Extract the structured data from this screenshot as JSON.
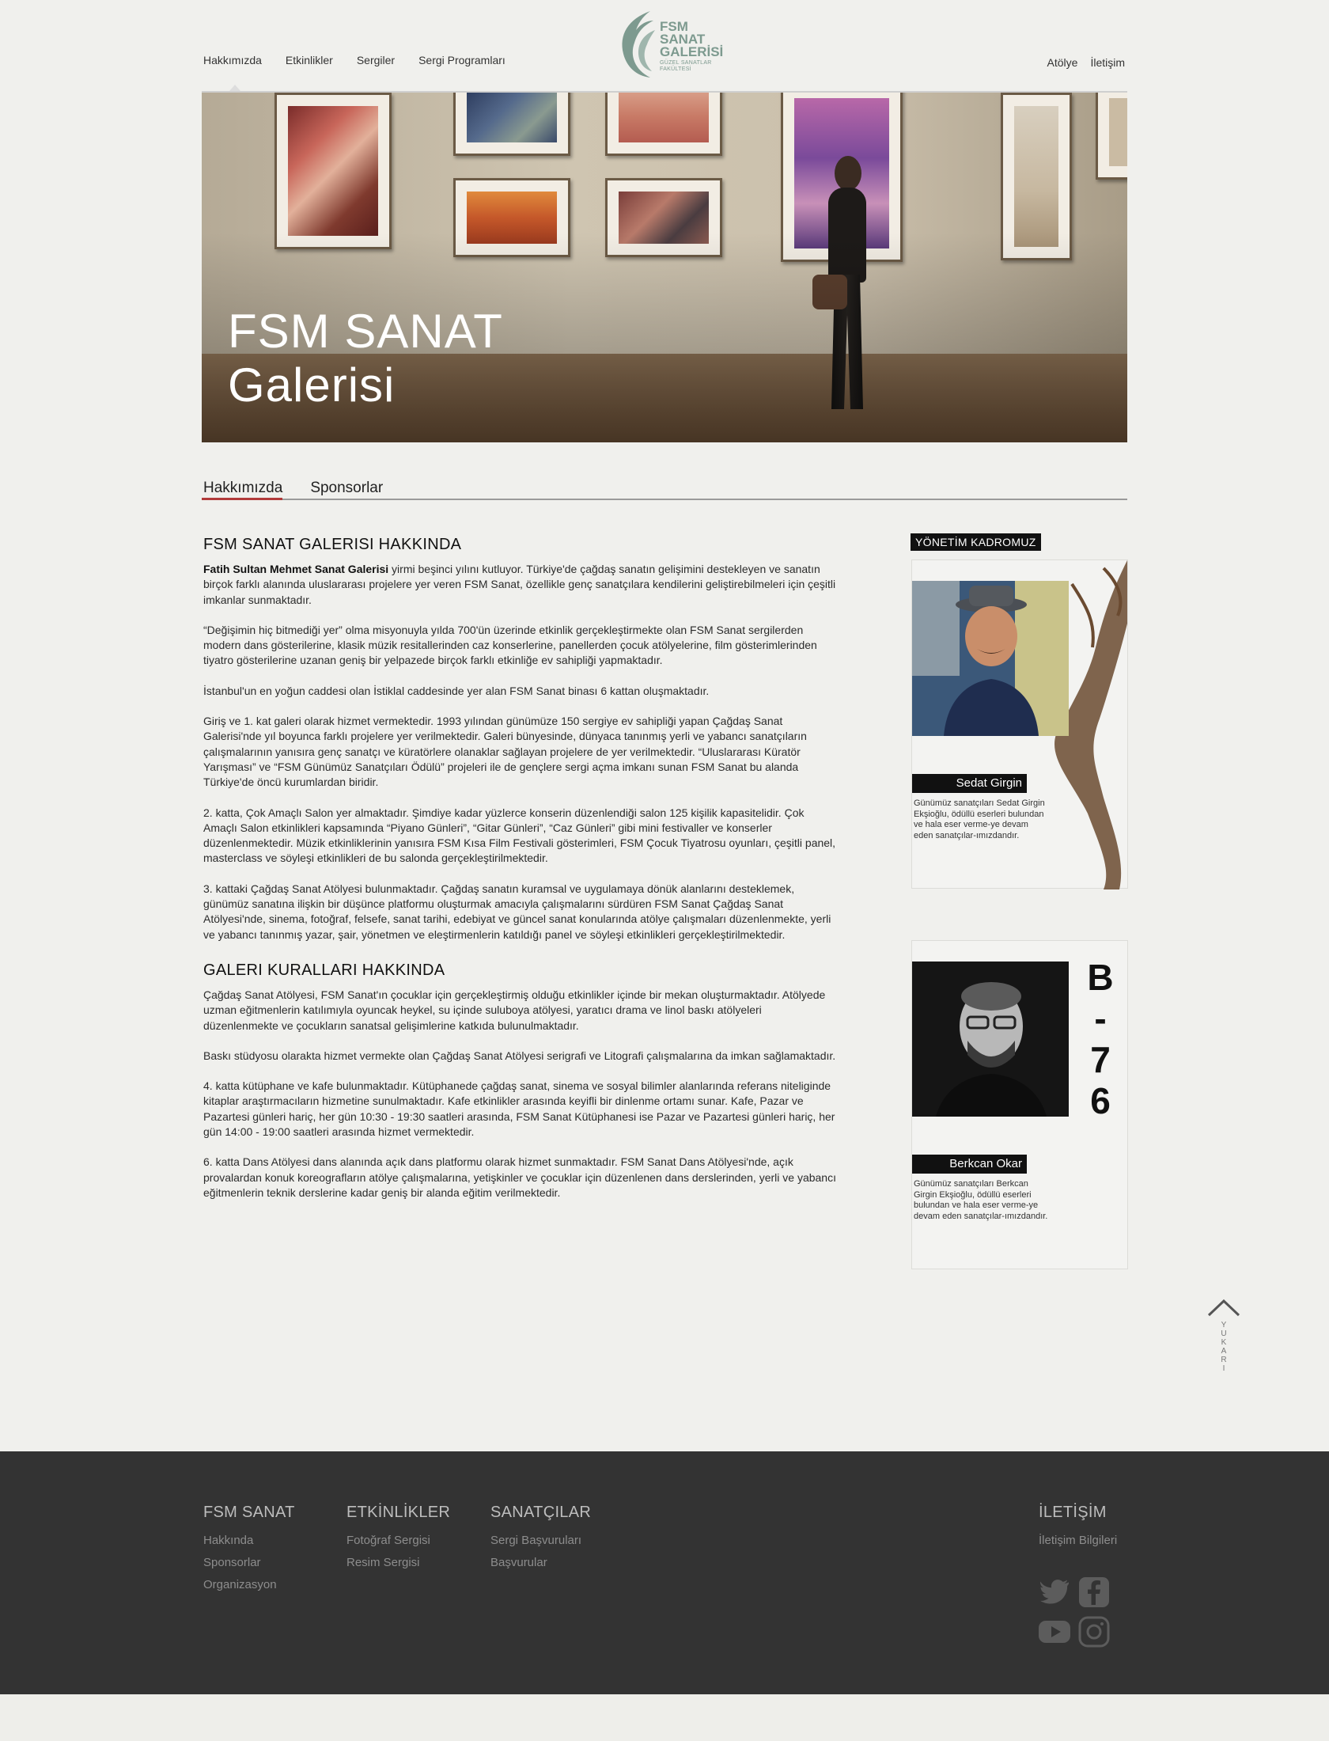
{
  "header": {
    "nav_left": [
      "Hakkımızda",
      "Etkinlikler",
      "Sergiler",
      "Sergi Programları"
    ],
    "nav_right": [
      "Atölye",
      "İletişim"
    ],
    "logo": {
      "line1": "FSM",
      "line2": "SANAT",
      "line3": "GALERİSİ",
      "sub1": "GÜZEL SANATLAR",
      "sub2": "FAKÜLTESİ"
    }
  },
  "hero": {
    "title_line1": "FSM SANAT",
    "title_line2": "Galerisi"
  },
  "subtabs": [
    "Hakkımızda",
    "Sponsorlar"
  ],
  "main": {
    "heading1": "FSM SANAT GALERISI HAKKINDA",
    "intro_bold": "Fatih Sultan Mehmet Sanat Galerisi",
    "intro_rest": " yirmi beşinci yılını kutluyor. Türkiye'de çağdaş sanatın gelişimini destekleyen ve sanatın birçok farklı alanında uluslararası projelere yer veren FSM Sanat, özellikle genç sanatçılara kendilerini geliştirebilmeleri için çeşitli imkanlar sunmaktadır.",
    "paragraphs": [
      "“Değişimin hiç bitmediği yer” olma misyonuyla yılda 700'ün üzerinde etkinlik gerçekleştirmekte olan FSM Sanat sergilerden modern dans gösterilerine, klasik müzik resitallerinden caz konserlerine, panellerden çocuk atölyelerine, film gösterimlerinden tiyatro gösterilerine  uzanan geniş bir yelpazede birçok farklı etkinliğe ev sahipliği yapmaktadır.",
      "İstanbul'un en yoğun caddesi olan İstiklal caddesinde yer alan FSM Sanat binası 6 kattan oluşmaktadır.",
      "Giriş ve 1. kat galeri olarak hizmet vermektedir. 1993 yılından günümüze 150  sergiye ev sahipliği yapan Çağdaş Sanat Galerisi'nde yıl boyunca farklı projelere yer verilmektedir.  Galeri bünyesinde, dünyaca tanınmış yerli ve yabancı sanatçıların çalışmalarının yanısıra  genç sanatçı ve küratörlere olanaklar sağlayan  projelere de yer verilmektedir. “Uluslararası Küratör Yarışması” ve “FSM Günümüz Sanatçıları Ödülü” projeleri ile de gençlere sergi açma imkanı sunan FSM Sanat bu alanda Türkiye'de öncü kurumlardan biridir.",
      "2. katta, Çok Amaçlı Salon yer almaktadır.  Şimdiye kadar yüzlerce konserin  düzenlendiği salon 125 kişilik kapasitelidir.   Çok Amaçlı Salon etkinlikleri kapsamında “Piyano Günleri”, “Gitar Günleri”, “Caz Günleri” gibi mini festivaller ve konserler düzenlenmektedir.  Müzik etkinliklerinin yanısıra FSM Kısa Film Festivali gösterimleri, FSM Çocuk Tiyatrosu oyunları, çeşitli panel, masterclass ve söyleşi etkinlikleri de bu salonda gerçekleştirilmektedir.",
      "3. kattaki Çağdaş Sanat Atölyesi bulunmaktadır. Çağdaş sanatın kuramsal ve uygulamaya dönük alanlarını desteklemek, günümüz sanatına ilişkin bir düşünce platformu oluşturmak amacıyla çalışmalarını sürdüren FSM Sanat Çağdaş Sanat Atölyesi'nde, sinema, fotoğraf, felsefe, sanat tarihi, edebiyat ve güncel sanat konularında atölye çalışmaları düzenlenmekte, yerli ve yabancı tanınmış yazar, şair, yönetmen ve eleştirmenlerin katıldığı panel ve söyleşi etkinlikleri gerçekleştirilmektedir."
    ],
    "heading2": "GALERI KURALLARI HAKKINDA",
    "paragraphs2": [
      "Çağdaş Sanat Atölyesi, FSM Sanat'ın çocuklar için gerçekleştirmiş olduğu etkinlikler içinde bir mekan oluşturmaktadır. Atölyede  uzman eğitmenlerin katılımıyla  oyuncak heykel, su içinde suluboya atölyesi, yaratıcı drama ve linol baskı atölyeleri düzenlenmekte ve çocukların sanatsal gelişimlerine katkıda bulunulmaktadır.",
      "Baskı stüdyosu olarakta hizmet vermekte olan Çağdaş Sanat Atölyesi  serigrafi ve Litografi çalışmalarına da imkan sağlamaktadır.",
      "4. katta kütüphane ve kafe bulunmaktadır. Kütüphanede çağdaş sanat, sinema ve sosyal bilimler alanlarında referans niteliginde kitaplar araştırmacıların hizmetine sunulmaktadır. Kafe etkinlikler arasında keyifli bir dinlenme ortamı sunar. Kafe, Pazar ve Pazartesi günleri hariç, her gün 10:30 - 19:30 saatleri arasında, FSM Sanat Kütüphanesi ise Pazar ve Pazartesi günleri hariç, her gün 14:00 - 19:00 saatleri arasında hizmet vermektedir.",
      "6. katta Dans Atölyesi dans alanında açık dans platformu  olarak hizmet sunmaktadır. FSM Sanat Dans Atölyesi'nde, açık provalardan konuk koreografların atölye çalışmalarına, yetişkinler ve çocuklar için düzenlenen dans derslerinden, yerli ve yabancı eğitmenlerin teknik derslerine kadar geniş bir alanda eğitim verilmektedir."
    ]
  },
  "sidebar": {
    "label": "YÖNETİM KADROMUZ",
    "cards": [
      {
        "name": "Sedat Girgin",
        "bio": "Günümüz sanatçıları Sedat Girgin Ekşioğlu, ödüllü eserleri bulundan ve hala eser verme-ye devam eden sanatçılar-ımızdandır."
      },
      {
        "name": "Berkcan Okar",
        "bio": "Günümüz sanatçıları Berkcan Girgin Ekşioğlu, ödüllü eserleri bulundan ve hala eser verme-ye devam eden sanatçılar-ımızdandır.",
        "badge": [
          "B",
          "-",
          "7",
          "6"
        ]
      }
    ]
  },
  "to_top": {
    "letters": [
      "Y",
      "U",
      "K",
      "A",
      "R",
      "I"
    ]
  },
  "footer": {
    "columns": [
      {
        "title": "FSM SANAT",
        "links": [
          "Hakkında",
          "Sponsorlar",
          "Organizasyon"
        ]
      },
      {
        "title": "ETKİNLİKLER",
        "links": [
          "Fotoğraf Sergisi",
          "Resim Sergisi"
        ]
      },
      {
        "title": "SANATÇILAR",
        "links": [
          "Sergi Başvuruları",
          "Başvurular"
        ]
      },
      {
        "title": "İLETİŞİM",
        "links": [
          "İletişim Bilgileri"
        ]
      }
    ],
    "social_icons": [
      "twitter-icon",
      "facebook-icon",
      "youtube-icon",
      "instagram-icon"
    ]
  },
  "colors": {
    "accent_red": "#b13a3a",
    "logo_green": "#7d9a8f",
    "footer_bg": "#333333",
    "page_bg": "#f0f0ed"
  }
}
